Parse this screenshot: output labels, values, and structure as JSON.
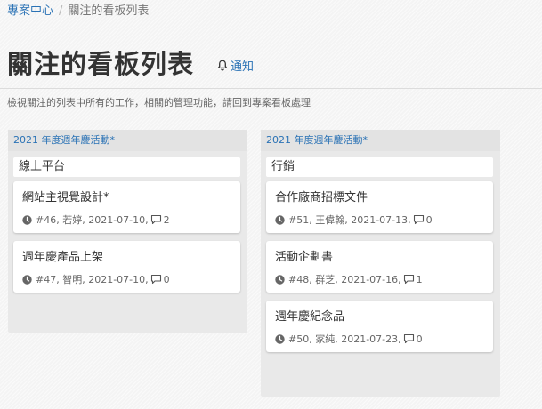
{
  "breadcrumb": {
    "home": "專案中心",
    "separator": "/",
    "current": "關注的看板列表"
  },
  "header": {
    "title": "關注的看板列表",
    "notify_label": "通知"
  },
  "description": "檢視關注的列表中所有的工作，相關的管理功能，請回到專案看板處理",
  "colors": {
    "link": "#2a72b5",
    "column_bg": "#e9e9e9",
    "card_bg": "#ffffff"
  },
  "boards": [
    {
      "name": "2021 年度週年慶活動*",
      "list": "線上平台",
      "cards": [
        {
          "title": "網站主視覺設計*",
          "meta": "#46, 若婷, 2021-07-10,",
          "comments": "2"
        },
        {
          "title": "週年慶產品上架",
          "meta": "#47, 智明, 2021-07-10,",
          "comments": "0"
        }
      ]
    },
    {
      "name": "2021 年度週年慶活動*",
      "list": "行銷",
      "cards": [
        {
          "title": "合作廠商招標文件",
          "meta": "#51, 王偉翰, 2021-07-13,",
          "comments": "0"
        },
        {
          "title": "活動企劃書",
          "meta": "#48, 群芝, 2021-07-16,",
          "comments": "1"
        },
        {
          "title": "週年慶紀念品",
          "meta": "#50, 家純, 2021-07-23,",
          "comments": "0"
        }
      ]
    }
  ]
}
